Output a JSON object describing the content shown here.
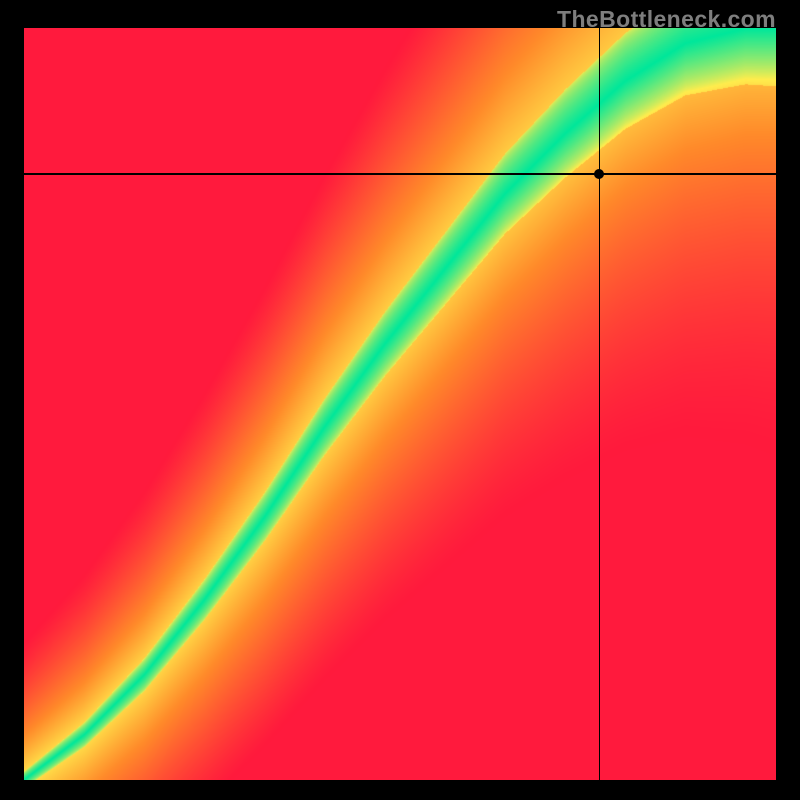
{
  "watermark": "TheBottleneck.com",
  "chart_data": {
    "type": "heatmap",
    "title": "",
    "xlabel": "",
    "ylabel": "",
    "xlim": [
      0,
      100
    ],
    "ylim": [
      0,
      100
    ],
    "colorscale": {
      "min_color": "#ff1744",
      "mid_yellow": "#ffed4e",
      "optimum_color": "#00e79b",
      "max_color": "#ff1744"
    },
    "optimal_curve_points": [
      {
        "x": 0,
        "y": 0
      },
      {
        "x": 8,
        "y": 6
      },
      {
        "x": 16,
        "y": 14
      },
      {
        "x": 24,
        "y": 24
      },
      {
        "x": 32,
        "y": 35
      },
      {
        "x": 40,
        "y": 47
      },
      {
        "x": 48,
        "y": 58
      },
      {
        "x": 56,
        "y": 68
      },
      {
        "x": 64,
        "y": 78
      },
      {
        "x": 72,
        "y": 86
      },
      {
        "x": 80,
        "y": 93
      },
      {
        "x": 88,
        "y": 98
      },
      {
        "x": 96,
        "y": 100
      }
    ],
    "crosshair": {
      "x": 76.5,
      "y": 80.6
    },
    "marker": {
      "x": 76.5,
      "y": 80.6
    }
  }
}
